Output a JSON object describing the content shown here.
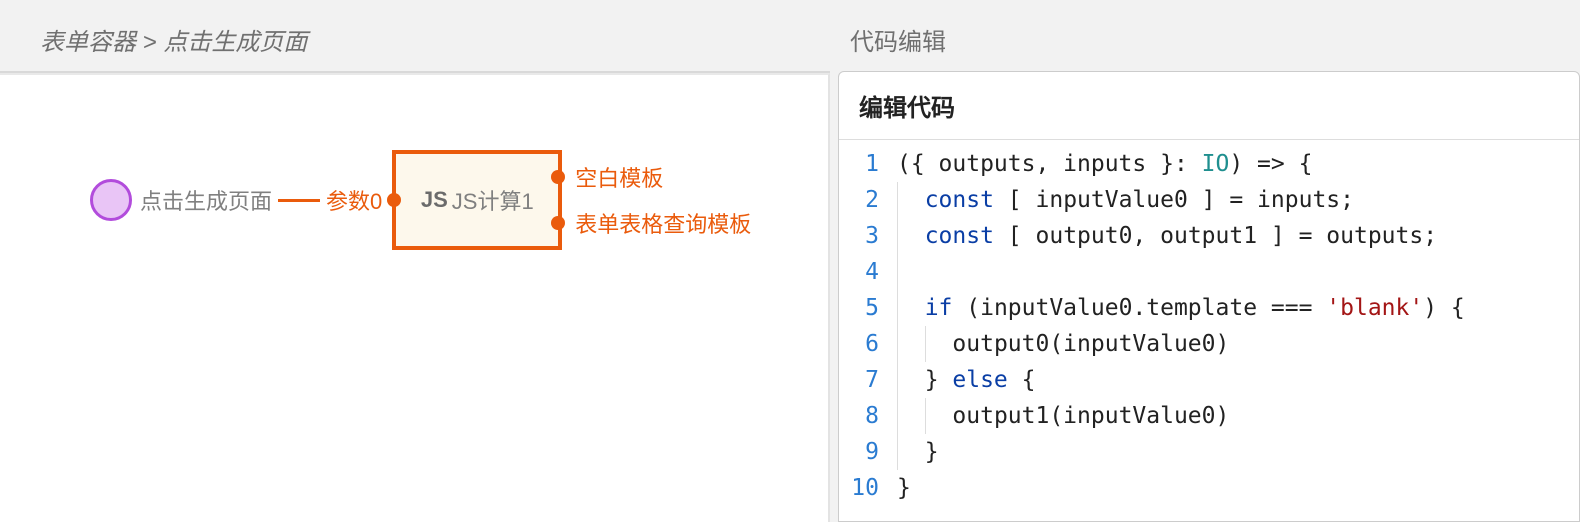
{
  "breadcrumb": {
    "root": "表单容器",
    "sep": " > ",
    "current": "点击生成页面"
  },
  "graph": {
    "trigger_label": "点击生成页面",
    "param_label": "参数0",
    "js_keyword": "JS",
    "js_label": "JS计算1",
    "outputs": [
      "空白模板",
      "表单表格查询模板"
    ]
  },
  "right": {
    "section_title": "代码编辑",
    "editor_title": "编辑代码"
  },
  "code": {
    "lines": [
      {
        "n": 1,
        "raw": "({ outputs, inputs }: IO) => {"
      },
      {
        "n": 2,
        "raw": "  const [ inputValue0 ] = inputs;"
      },
      {
        "n": 3,
        "raw": "  const [ output0, output1 ] = outputs;"
      },
      {
        "n": 4,
        "raw": ""
      },
      {
        "n": 5,
        "raw": "  if (inputValue0.template === 'blank') {"
      },
      {
        "n": 6,
        "raw": "    output0(inputValue0)"
      },
      {
        "n": 7,
        "raw": "  } else {"
      },
      {
        "n": 8,
        "raw": "    output1(inputValue0)"
      },
      {
        "n": 9,
        "raw": "  }"
      },
      {
        "n": 10,
        "raw": "}"
      }
    ]
  }
}
